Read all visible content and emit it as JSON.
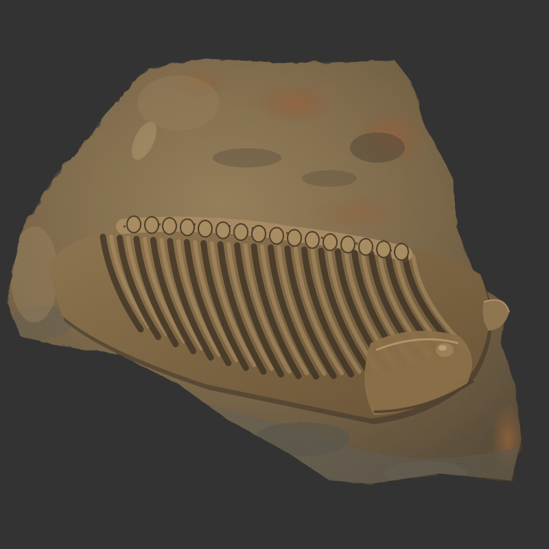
{
  "scene": {
    "background_color": "#333333",
    "subject": "fossil-rock-specimen",
    "colors": {
      "rock_base": "#7a6443",
      "rock_light": "#9a8058",
      "rock_dark": "#4f4030",
      "rust": "#8a4f2c",
      "grey_stone": "#5d5a52",
      "fossil_rib": "#6b5436",
      "fossil_highlight": "#b09468"
    }
  }
}
